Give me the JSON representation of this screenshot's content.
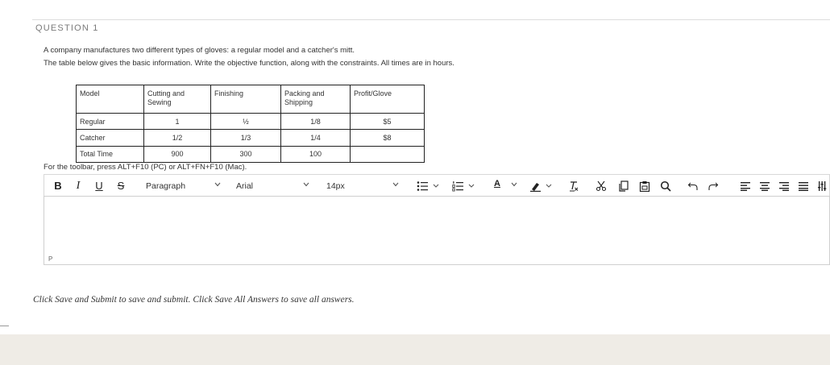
{
  "question": {
    "heading": "QUESTION 1",
    "prompt_line_1": "A company manufactures two different types of gloves: a regular model and a catcher's mitt.",
    "prompt_line_2": "The table below gives the basic information.  Write the objective function, along with the constraints.  All times are in hours."
  },
  "table": {
    "headers": [
      "Model",
      "Cutting and Sewing",
      "Finishing",
      "Packing and Shipping",
      "Profit/Glove"
    ],
    "rows": [
      [
        "Regular",
        "1",
        "½",
        "1/8",
        "$5"
      ],
      [
        "Catcher",
        "1/2",
        "1/3",
        "1/4",
        "$8"
      ],
      [
        "Total Time",
        "900",
        "300",
        "100",
        ""
      ]
    ]
  },
  "editor": {
    "toolbar_hint": "For the toolbar, press ALT+F10 (PC) or ALT+FN+F10 (Mac).",
    "bold_label": "B",
    "italic_label": "I",
    "underline_label": "U",
    "strike_label": "S",
    "block_format": "Paragraph",
    "font_family": "Arial",
    "font_size": "14px",
    "text_color_label": "A",
    "path_indicator": "P",
    "accent_color": "#222222"
  },
  "footer_note": "Click Save and Submit to save and submit. Click Save All Answers to save all answers."
}
